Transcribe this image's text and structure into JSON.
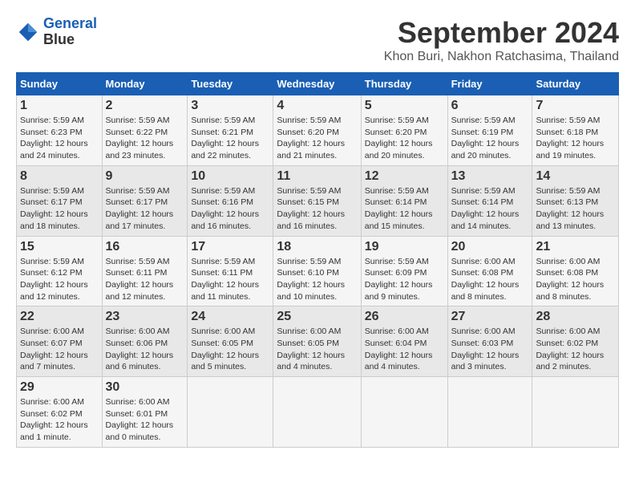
{
  "header": {
    "logo_line1": "General",
    "logo_line2": "Blue",
    "month": "September 2024",
    "location": "Khon Buri, Nakhon Ratchasima, Thailand"
  },
  "weekdays": [
    "Sunday",
    "Monday",
    "Tuesday",
    "Wednesday",
    "Thursday",
    "Friday",
    "Saturday"
  ],
  "weeks": [
    [
      {
        "day": "1",
        "sunrise": "5:59 AM",
        "sunset": "6:23 PM",
        "daylight": "12 hours and 24 minutes."
      },
      {
        "day": "2",
        "sunrise": "5:59 AM",
        "sunset": "6:22 PM",
        "daylight": "12 hours and 23 minutes."
      },
      {
        "day": "3",
        "sunrise": "5:59 AM",
        "sunset": "6:21 PM",
        "daylight": "12 hours and 22 minutes."
      },
      {
        "day": "4",
        "sunrise": "5:59 AM",
        "sunset": "6:20 PM",
        "daylight": "12 hours and 21 minutes."
      },
      {
        "day": "5",
        "sunrise": "5:59 AM",
        "sunset": "6:20 PM",
        "daylight": "12 hours and 20 minutes."
      },
      {
        "day": "6",
        "sunrise": "5:59 AM",
        "sunset": "6:19 PM",
        "daylight": "12 hours and 20 minutes."
      },
      {
        "day": "7",
        "sunrise": "5:59 AM",
        "sunset": "6:18 PM",
        "daylight": "12 hours and 19 minutes."
      }
    ],
    [
      {
        "day": "8",
        "sunrise": "5:59 AM",
        "sunset": "6:17 PM",
        "daylight": "12 hours and 18 minutes."
      },
      {
        "day": "9",
        "sunrise": "5:59 AM",
        "sunset": "6:17 PM",
        "daylight": "12 hours and 17 minutes."
      },
      {
        "day": "10",
        "sunrise": "5:59 AM",
        "sunset": "6:16 PM",
        "daylight": "12 hours and 16 minutes."
      },
      {
        "day": "11",
        "sunrise": "5:59 AM",
        "sunset": "6:15 PM",
        "daylight": "12 hours and 16 minutes."
      },
      {
        "day": "12",
        "sunrise": "5:59 AM",
        "sunset": "6:14 PM",
        "daylight": "12 hours and 15 minutes."
      },
      {
        "day": "13",
        "sunrise": "5:59 AM",
        "sunset": "6:14 PM",
        "daylight": "12 hours and 14 minutes."
      },
      {
        "day": "14",
        "sunrise": "5:59 AM",
        "sunset": "6:13 PM",
        "daylight": "12 hours and 13 minutes."
      }
    ],
    [
      {
        "day": "15",
        "sunrise": "5:59 AM",
        "sunset": "6:12 PM",
        "daylight": "12 hours and 12 minutes."
      },
      {
        "day": "16",
        "sunrise": "5:59 AM",
        "sunset": "6:11 PM",
        "daylight": "12 hours and 12 minutes."
      },
      {
        "day": "17",
        "sunrise": "5:59 AM",
        "sunset": "6:11 PM",
        "daylight": "12 hours and 11 minutes."
      },
      {
        "day": "18",
        "sunrise": "5:59 AM",
        "sunset": "6:10 PM",
        "daylight": "12 hours and 10 minutes."
      },
      {
        "day": "19",
        "sunrise": "5:59 AM",
        "sunset": "6:09 PM",
        "daylight": "12 hours and 9 minutes."
      },
      {
        "day": "20",
        "sunrise": "6:00 AM",
        "sunset": "6:08 PM",
        "daylight": "12 hours and 8 minutes."
      },
      {
        "day": "21",
        "sunrise": "6:00 AM",
        "sunset": "6:08 PM",
        "daylight": "12 hours and 8 minutes."
      }
    ],
    [
      {
        "day": "22",
        "sunrise": "6:00 AM",
        "sunset": "6:07 PM",
        "daylight": "12 hours and 7 minutes."
      },
      {
        "day": "23",
        "sunrise": "6:00 AM",
        "sunset": "6:06 PM",
        "daylight": "12 hours and 6 minutes."
      },
      {
        "day": "24",
        "sunrise": "6:00 AM",
        "sunset": "6:05 PM",
        "daylight": "12 hours and 5 minutes."
      },
      {
        "day": "25",
        "sunrise": "6:00 AM",
        "sunset": "6:05 PM",
        "daylight": "12 hours and 4 minutes."
      },
      {
        "day": "26",
        "sunrise": "6:00 AM",
        "sunset": "6:04 PM",
        "daylight": "12 hours and 4 minutes."
      },
      {
        "day": "27",
        "sunrise": "6:00 AM",
        "sunset": "6:03 PM",
        "daylight": "12 hours and 3 minutes."
      },
      {
        "day": "28",
        "sunrise": "6:00 AM",
        "sunset": "6:02 PM",
        "daylight": "12 hours and 2 minutes."
      }
    ],
    [
      {
        "day": "29",
        "sunrise": "6:00 AM",
        "sunset": "6:02 PM",
        "daylight": "12 hours and 1 minute."
      },
      {
        "day": "30",
        "sunrise": "6:00 AM",
        "sunset": "6:01 PM",
        "daylight": "12 hours and 0 minutes."
      },
      null,
      null,
      null,
      null,
      null
    ]
  ]
}
